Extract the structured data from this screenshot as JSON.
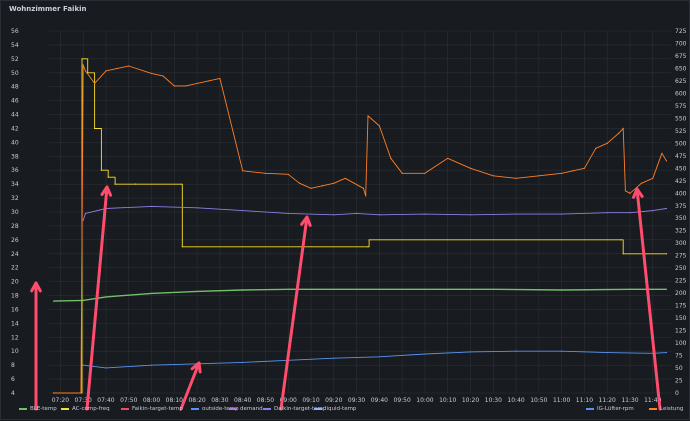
{
  "panel": {
    "title": "Wohnzimmer Faikin"
  },
  "chart_data": {
    "type": "line",
    "left_axis": {
      "range": [
        4,
        56
      ],
      "ticks": [
        4,
        6,
        8,
        10,
        12,
        14,
        16,
        18,
        20,
        22,
        24,
        26,
        28,
        30,
        32,
        34,
        36,
        38,
        40,
        42,
        44,
        46,
        48,
        50,
        52,
        54,
        56
      ]
    },
    "right_axis": {
      "range": [
        0,
        725
      ],
      "ticks": [
        0,
        25,
        50,
        75,
        100,
        125,
        150,
        175,
        200,
        225,
        250,
        275,
        300,
        325,
        350,
        375,
        400,
        425,
        450,
        475,
        500,
        525,
        550,
        575,
        600,
        625,
        650,
        675,
        700,
        725
      ]
    },
    "x_axis": {
      "ticks": [
        "07:20",
        "07:30",
        "07:40",
        "07:50",
        "08:00",
        "08:10",
        "08:20",
        "08:30",
        "08:40",
        "08:50",
        "09:00",
        "09:10",
        "09:20",
        "09:30",
        "09:40",
        "09:50",
        "10:00",
        "10:10",
        "10:20",
        "10:30",
        "10:40",
        "10:50",
        "11:00",
        "11:10",
        "11:20",
        "11:30",
        "11:40"
      ]
    },
    "grid": true,
    "series": [
      {
        "name": "BLE-temp",
        "color": "#73bf69",
        "axis": "left",
        "x": [
          "07:17",
          "07:30",
          "07:40",
          "08:00",
          "08:20",
          "08:40",
          "09:00",
          "09:30",
          "10:00",
          "10:30",
          "11:00",
          "11:30",
          "11:46"
        ],
        "y": [
          17.2,
          17.3,
          17.8,
          18.3,
          18.6,
          18.8,
          18.9,
          18.9,
          18.9,
          18.9,
          18.8,
          18.9,
          18.9
        ]
      },
      {
        "name": "AC-comp-freq",
        "color": "#fade2a",
        "axis": "left",
        "x": [
          "07:17",
          "07:29",
          "07:29.5",
          "07:32",
          "07:35",
          "07:38",
          "07:41",
          "07:44",
          "07:53",
          "08:13",
          "08:13.5",
          "09:35",
          "09:35.5",
          "11:26",
          "11:27",
          "11:46"
        ],
        "y": [
          4,
          4,
          52,
          50,
          42,
          36,
          35,
          34,
          34,
          34,
          25,
          25,
          26,
          26,
          24,
          24
        ]
      },
      {
        "name": "Faikin-target-temp",
        "color": "#f2495c",
        "axis": "left",
        "x": [],
        "y": []
      },
      {
        "name": "outside-temp",
        "color": "#5794f2",
        "axis": "left",
        "x": [
          "07:30",
          "07:40",
          "08:00",
          "08:20",
          "08:40",
          "09:00",
          "09:20",
          "09:40",
          "10:00",
          "10:20",
          "10:40",
          "11:00",
          "11:20",
          "11:40",
          "11:46"
        ],
        "y": [
          8.0,
          7.6,
          8.0,
          8.2,
          8.4,
          8.7,
          9.0,
          9.2,
          9.6,
          9.9,
          10.0,
          10.0,
          9.8,
          9.7,
          9.8
        ]
      },
      {
        "name": "demand",
        "color": "#b877d9",
        "axis": "left",
        "x": [],
        "y": []
      },
      {
        "name": "Daikin-target-temp",
        "color": "#8f7ee6",
        "axis": "left",
        "x": [
          "07:30",
          "07:31",
          "07:40",
          "08:00",
          "08:20",
          "08:40",
          "09:00",
          "09:20",
          "09:30",
          "09:40",
          "10:00",
          "10:20",
          "10:40",
          "11:00",
          "11:20",
          "11:30",
          "11:40",
          "11:46"
        ],
        "y": [
          28.8,
          29.8,
          30.5,
          30.8,
          30.6,
          30.2,
          29.8,
          29.6,
          29.8,
          29.6,
          29.7,
          29.6,
          29.7,
          29.7,
          29.9,
          29.9,
          30.2,
          30.5
        ]
      },
      {
        "name": "liquid-temp",
        "color": "#8ab8ff",
        "axis": "left",
        "x": [],
        "y": []
      },
      {
        "name": "IG-Lüfter-rpm",
        "color": "#5794f2",
        "axis": "right",
        "x": [],
        "y": []
      },
      {
        "name": "Leistung",
        "color": "#ff7f27",
        "axis": "right",
        "x": [
          "07:17",
          "07:29",
          "07:30",
          "07:31",
          "07:35",
          "07:40",
          "07:45",
          "07:50",
          "08:00",
          "08:05",
          "08:10",
          "08:15",
          "08:20",
          "08:25",
          "08:30",
          "08:40",
          "08:50",
          "09:00",
          "09:05",
          "09:10",
          "09:15",
          "09:20",
          "09:25",
          "09:33",
          "09:34",
          "09:35",
          "09:40",
          "09:45",
          "09:50",
          "10:00",
          "10:10",
          "10:20",
          "10:30",
          "10:40",
          "10:50",
          "11:00",
          "11:05",
          "11:10",
          "11:15",
          "11:20",
          "11:25",
          "11:27",
          "11:28",
          "11:30",
          "11:35",
          "11:40",
          "11:44",
          "11:46"
        ],
        "y": [
          0,
          0,
          657,
          645,
          620,
          645,
          650,
          655,
          640,
          635,
          615,
          615,
          620,
          625,
          630,
          445,
          440,
          438,
          420,
          410,
          415,
          420,
          430,
          410,
          395,
          555,
          535,
          470,
          440,
          440,
          470,
          450,
          435,
          430,
          435,
          440,
          445,
          450,
          490,
          500,
          520,
          530,
          405,
          400,
          420,
          430,
          480,
          465
        ]
      }
    ]
  },
  "legend": [
    {
      "label": "BLE-temp",
      "color": "#73bf69"
    },
    {
      "label": "AC-comp-freq",
      "color": "#fade2a"
    },
    {
      "label": "Faikin-target-temp",
      "color": "#f2495c"
    },
    {
      "label": "outside-temp",
      "color": "#5794f2"
    },
    {
      "label": "demand",
      "color": "#b877d9"
    },
    {
      "label": "Daikin-target-temp",
      "color": "#8f7ee6"
    },
    {
      "label": "liquid-temp",
      "color": "#8ab8ff"
    },
    {
      "label": "IG-Lüfter-rpm",
      "color": "#5794f2"
    },
    {
      "label": "Leistung",
      "color": "#ff7f27"
    }
  ],
  "annotation_arrows": [
    {
      "target": "BLE-temp",
      "color": "#ff4d6d"
    },
    {
      "target": "AC-comp-freq",
      "color": "#ff4d6d"
    },
    {
      "target": "outside-temp",
      "color": "#ff4d6d"
    },
    {
      "target": "Daikin-target-temp",
      "color": "#ff4d6d"
    },
    {
      "target": "Leistung",
      "color": "#ff4d6d"
    }
  ]
}
